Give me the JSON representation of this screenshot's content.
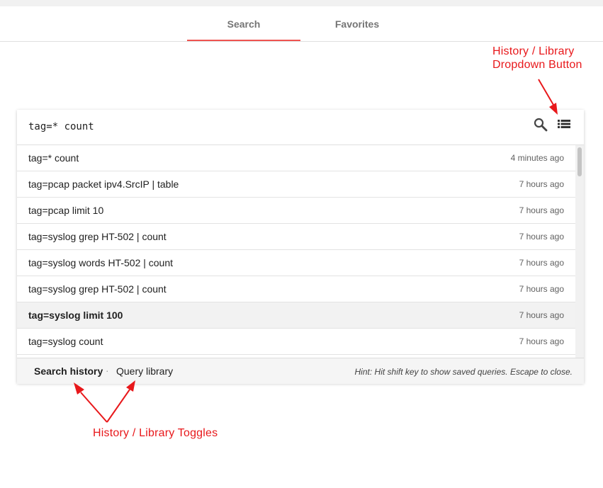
{
  "tabs": [
    {
      "label": "Search",
      "active": true
    },
    {
      "label": "Favorites",
      "active": false
    }
  ],
  "colors": {
    "accent": "#ef5350",
    "annotation": "#e8181b"
  },
  "search": {
    "query": "tag=* count",
    "search_icon": "search-icon",
    "dropdown_icon": "list-icon"
  },
  "history": [
    {
      "query": "tag=* count",
      "time": "4 minutes ago"
    },
    {
      "query": "tag=pcap packet ipv4.SrcIP | table",
      "time": "7 hours ago"
    },
    {
      "query": "tag=pcap limit 10",
      "time": "7 hours ago"
    },
    {
      "query": "tag=syslog grep HT-502 | count",
      "time": "7 hours ago"
    },
    {
      "query": "tag=syslog words HT-502 | count",
      "time": "7 hours ago"
    },
    {
      "query": "tag=syslog grep HT-502 | count",
      "time": "7 hours ago"
    },
    {
      "query": "tag=syslog limit 100",
      "time": "7 hours ago",
      "highlighted": true
    },
    {
      "query": "tag=syslog count",
      "time": "7 hours ago"
    }
  ],
  "footer": {
    "history_toggle": "Search history",
    "separator": "·",
    "library_toggle": "Query library",
    "hint": "Hint: Hit shift key to show saved queries. Escape to close."
  },
  "annotations": {
    "dropdown_line1": "History / Library",
    "dropdown_line2": "Dropdown Button",
    "toggles": "History / Library Toggles"
  }
}
